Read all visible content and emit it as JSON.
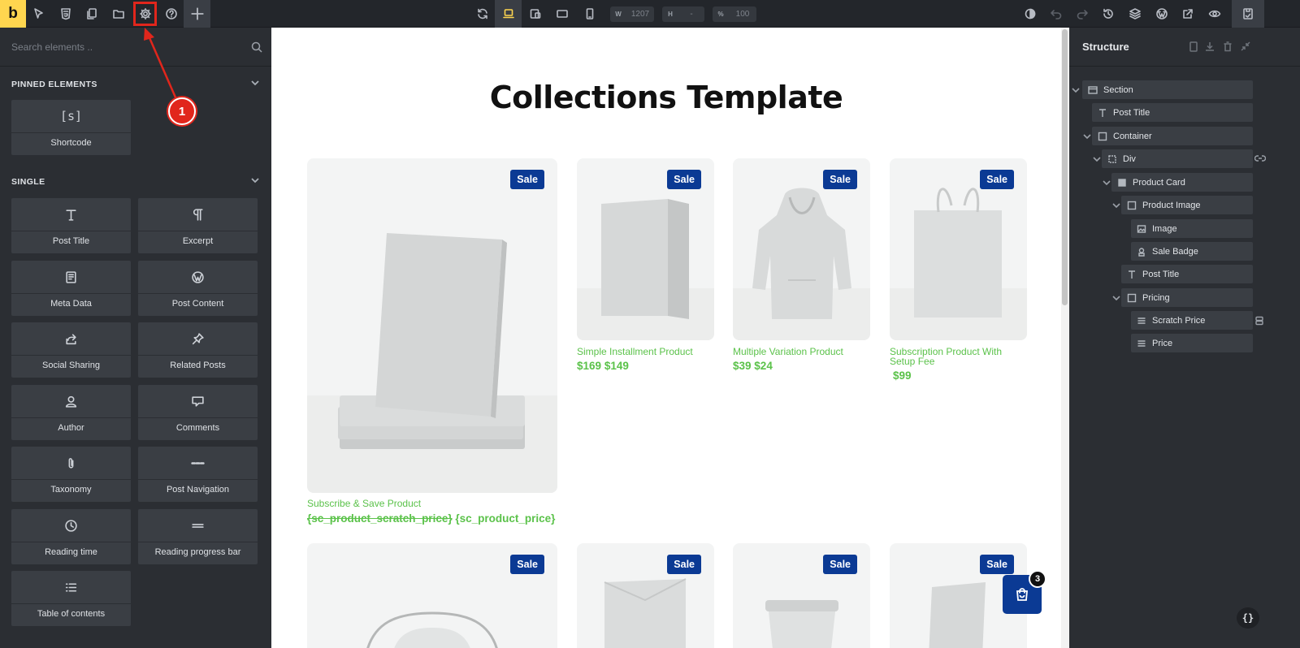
{
  "app": {
    "logo": "b"
  },
  "toolbar": {
    "width": {
      "label": "W",
      "value": "1207"
    },
    "height": {
      "label": "H",
      "value": "-"
    },
    "zoom": {
      "label": "%",
      "value": "100"
    }
  },
  "left_panel": {
    "search_placeholder": "Search elements ..",
    "sections": [
      {
        "title": "PINNED ELEMENTS",
        "items": [
          {
            "label": "Shortcode",
            "icon": "shortcode-icon"
          }
        ]
      },
      {
        "title": "SINGLE",
        "items": [
          {
            "label": "Post Title",
            "icon": "text-icon"
          },
          {
            "label": "Excerpt",
            "icon": "paragraph-icon"
          },
          {
            "label": "Meta Data",
            "icon": "meta-icon"
          },
          {
            "label": "Post Content",
            "icon": "wordpress-icon"
          },
          {
            "label": "Social Sharing",
            "icon": "share-icon"
          },
          {
            "label": "Related Posts",
            "icon": "pin-icon"
          },
          {
            "label": "Author",
            "icon": "user-icon"
          },
          {
            "label": "Comments",
            "icon": "comment-icon"
          },
          {
            "label": "Taxonomy",
            "icon": "paperclip-icon"
          },
          {
            "label": "Post Navigation",
            "icon": "navigation-icon"
          },
          {
            "label": "Reading time",
            "icon": "clock-icon"
          },
          {
            "label": "Reading progress bar",
            "icon": "progress-icon"
          },
          {
            "label": "Table of contents",
            "icon": "list-icon"
          }
        ]
      }
    ]
  },
  "annotation": {
    "step": "1"
  },
  "canvas": {
    "title": "Collections Template",
    "sale_label": "Sale",
    "products": [
      {
        "title": "Subscribe & Save Product",
        "scratch_price": "{sc_product_scratch_price}",
        "price": "{sc_product_price}",
        "image": "book"
      },
      {
        "title": "Simple Installment Product",
        "scratch_price": "$169",
        "price": "$149",
        "image": "box"
      },
      {
        "title": "Multiple Variation Product",
        "scratch_price": "$39",
        "price": "$24",
        "image": "hoodie"
      },
      {
        "title": "Subscription Product With Setup Fee",
        "scratch_price": "",
        "price": "$99",
        "image": "bag"
      },
      {
        "title": "",
        "image": "drawstring-bag"
      },
      {
        "title": "",
        "image": "envelope"
      },
      {
        "title": "",
        "image": "cup"
      },
      {
        "title": "",
        "image": "book-2"
      }
    ],
    "cart_count": "3"
  },
  "structure": {
    "title": "Structure",
    "nodes": [
      {
        "label": "Section",
        "icon": "section-icon"
      },
      {
        "label": "Post Title",
        "icon": "text-icon"
      },
      {
        "label": "Container",
        "icon": "container-icon"
      },
      {
        "label": "Div",
        "icon": "div-icon"
      },
      {
        "label": "Product Card",
        "icon": "product-card-icon"
      },
      {
        "label": "Product Image",
        "icon": "box-icon"
      },
      {
        "label": "Image",
        "icon": "image-icon"
      },
      {
        "label": "Sale Badge",
        "icon": "badge-icon"
      },
      {
        "label": "Post Title",
        "icon": "text-icon"
      },
      {
        "label": "Pricing",
        "icon": "box-icon"
      },
      {
        "label": "Scratch Price",
        "icon": "lines-icon"
      },
      {
        "label": "Price",
        "icon": "lines-icon"
      }
    ]
  },
  "code_button": "{}"
}
